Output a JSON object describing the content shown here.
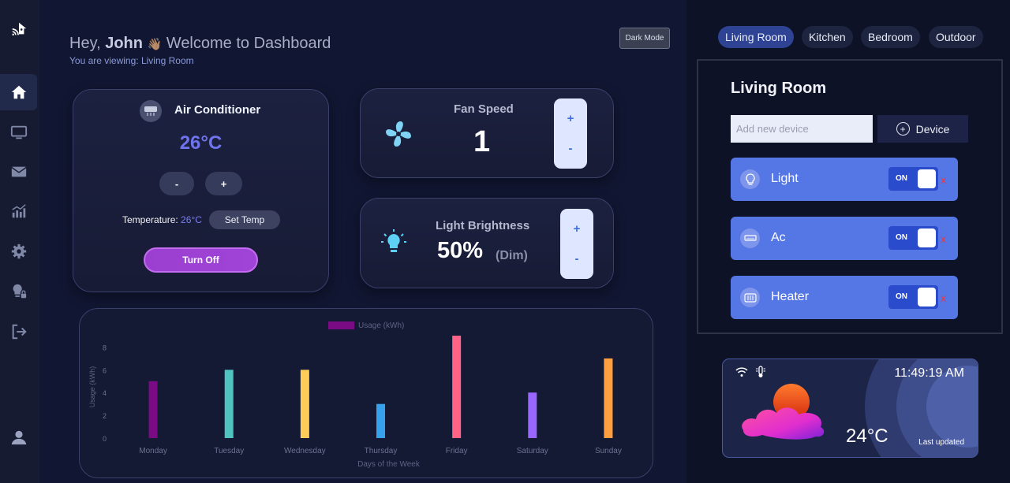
{
  "header": {
    "greeting_prefix": "Hey,",
    "user_name": "John",
    "wave_emoji": "👋🏽",
    "greeting_suffix": "Welcome to Dashboard",
    "viewing_text": "You are viewing: Living Room",
    "dark_mode_label": "Dark Mode"
  },
  "sidebar": {
    "items": [
      {
        "name": "home-icon",
        "active": true
      },
      {
        "name": "monitor-icon",
        "active": false
      },
      {
        "name": "mail-icon",
        "active": false
      },
      {
        "name": "chart-icon",
        "active": false
      },
      {
        "name": "gear-icon",
        "active": false
      },
      {
        "name": "bulb-lock-icon",
        "active": false
      },
      {
        "name": "logout-icon",
        "active": false
      }
    ],
    "user_icon": "user-icon"
  },
  "ac_card": {
    "title": "Air Conditioner",
    "temperature": "26°C",
    "minus_label": "-",
    "plus_label": "+",
    "temp_label": "Temperature:",
    "temp_value": "26°C",
    "set_temp_label": "Set Temp",
    "turn_off_label": "Turn Off"
  },
  "fan_card": {
    "title": "Fan Speed",
    "value": "1",
    "plus_label": "+",
    "minus_label": "-"
  },
  "light_card": {
    "title": "Light Brightness",
    "value": "50%",
    "level": "(Dim)",
    "plus_label": "+",
    "minus_label": "-"
  },
  "chart_data": {
    "type": "bar",
    "title": "",
    "legend": "Usage (kWh)",
    "legend_color": "#7b0b84",
    "xlabel": "Days of the Week",
    "ylabel": "Usage (kWh)",
    "ylim": [
      0,
      9
    ],
    "yticks": [
      0,
      2,
      4,
      6,
      8
    ],
    "categories": [
      "Monday",
      "Tuesday",
      "Wednesday",
      "Thursday",
      "Friday",
      "Saturday",
      "Sunday"
    ],
    "values": [
      5,
      6,
      6,
      3,
      9,
      4,
      7
    ],
    "colors": [
      "#7b0b84",
      "#4ec3c0",
      "#ffcd57",
      "#36a2eb",
      "#ff6385",
      "#9966ff",
      "#ff9f40"
    ],
    "grid": false
  },
  "rooms": {
    "tabs": [
      "Living Room",
      "Kitchen",
      "Bedroom",
      "Outdoor"
    ],
    "active_tab": "Living Room"
  },
  "room_panel": {
    "title": "Living Room",
    "add_placeholder": "Add new device",
    "add_button_label": "Device",
    "devices": [
      {
        "name": "Light",
        "state": "ON",
        "remove": "x",
        "icon": "bulb-icon"
      },
      {
        "name": "Ac",
        "state": "ON",
        "remove": "x",
        "icon": "ac-icon"
      },
      {
        "name": "Heater",
        "state": "ON",
        "remove": "x",
        "icon": "heater-icon"
      }
    ]
  },
  "weather": {
    "time": "11:49:19 AM",
    "temperature": "24°C",
    "updated_label": "Last updated",
    "icons": [
      "wifi-icon",
      "thermometer-icon",
      "sun-cloud-icon"
    ]
  },
  "colors": {
    "accent": "#5576e5",
    "ac_temp": "#6f74ee",
    "turn_off": "#9b3fd0"
  }
}
